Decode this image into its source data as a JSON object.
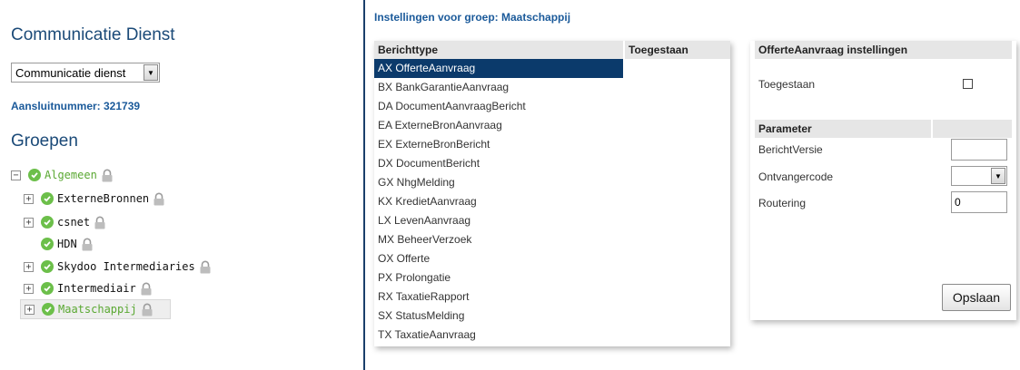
{
  "left": {
    "service_title": "Communicatie Dienst",
    "service_select_value": "Communicatie dienst",
    "aansluitnummer": "Aansluitnummer: 321739",
    "groups_title": "Groepen",
    "tree": [
      {
        "label": "Algemeen",
        "toggle": "⊟"
      },
      {
        "label": "ExterneBronnen",
        "toggle": "⊞"
      },
      {
        "label": "csnet",
        "toggle": "⊞"
      },
      {
        "label": "HDN",
        "toggle": ""
      },
      {
        "label": "Skydoo Intermediaries",
        "toggle": "⊞"
      },
      {
        "label": "Intermediair",
        "toggle": "⊞"
      },
      {
        "label": "Maatschappij",
        "toggle": "⊞"
      }
    ]
  },
  "middle": {
    "title": "Instellingen voor groep: Maatschappij",
    "col_berichttype": "Berichttype",
    "col_toegestaan": "Toegestaan",
    "rows": [
      "AX OfferteAanvraag",
      "BX BankGarantieAanvraag",
      "DA DocumentAanvraagBericht",
      "EA ExterneBronAanvraag",
      "EX ExterneBronBericht",
      "DX DocumentBericht",
      "GX NhgMelding",
      "KX KredietAanvraag",
      "LX LevenAanvraag",
      "MX BeheerVerzoek",
      "OX Offerte",
      "PX Prolongatie",
      "RX TaxatieRapport",
      "SX StatusMelding",
      "TX TaxatieAanvraag"
    ],
    "selected_row": "AX OfferteAanvraag"
  },
  "right": {
    "title": "OfferteAanvraag instellingen",
    "toegestaan_label": "Toegestaan",
    "toegestaan_checked": false,
    "parameter_header": "Parameter",
    "params": {
      "berichtversie_label": "BerichtVersie",
      "berichtversie_value": "",
      "ontvangercode_label": "Ontvangercode",
      "ontvangercode_value": "",
      "routering_label": "Routering",
      "routering_value": "0"
    },
    "save_label": "Opslaan"
  },
  "colors": {
    "heading_blue": "#1b4a78",
    "link_blue": "#1b5a9a",
    "selected_row_bg": "#0b3a6b",
    "status_green": "#6cbf4a",
    "tree_selected_text": "#5aa832"
  },
  "icons": {
    "status": "check-circle-icon",
    "lock": "lock-icon",
    "expand": "plus-box-icon",
    "collapse": "minus-box-icon",
    "dropdown": "chevron-down-icon"
  }
}
